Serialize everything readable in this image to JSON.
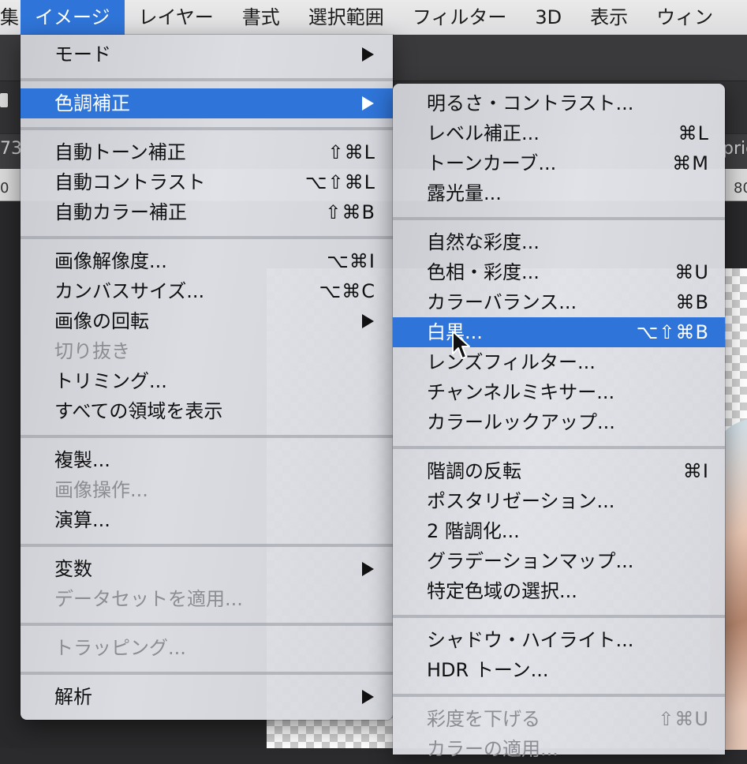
{
  "menubar": {
    "items": [
      "集",
      "イメージ",
      "レイヤー",
      "書式",
      "選択範囲",
      "フィルター",
      "3D",
      "表示",
      "ウィン"
    ]
  },
  "background": {
    "ruler_row_left": "73",
    "ruler_row_right": "pric",
    "ruler_left": "0",
    "ruler_right": "80"
  },
  "image_menu": {
    "items": [
      {
        "label": "モード",
        "submenu": true
      },
      {
        "label": "色調補正",
        "submenu": true,
        "highlighted": true
      },
      {
        "label": "自動トーン補正",
        "shortcut": "⇧⌘L"
      },
      {
        "label": "自動コントラスト",
        "shortcut": "⌥⇧⌘L"
      },
      {
        "label": "自動カラー補正",
        "shortcut": "⇧⌘B"
      },
      {
        "label": "画像解像度...",
        "shortcut": "⌥⌘I"
      },
      {
        "label": "カンバスサイズ...",
        "shortcut": "⌥⌘C"
      },
      {
        "label": "画像の回転",
        "submenu": true
      },
      {
        "label": "切り抜き",
        "disabled": true
      },
      {
        "label": "トリミング..."
      },
      {
        "label": "すべての領域を表示"
      },
      {
        "label": "複製..."
      },
      {
        "label": "画像操作...",
        "disabled": true
      },
      {
        "label": "演算..."
      },
      {
        "label": "変数",
        "submenu": true
      },
      {
        "label": "データセットを適用...",
        "disabled": true
      },
      {
        "label": "トラッピング...",
        "disabled": true
      },
      {
        "label": "解析",
        "submenu": true
      }
    ]
  },
  "adjustments_menu": {
    "items": [
      {
        "label": "明るさ・コントラスト..."
      },
      {
        "label": "レベル補正...",
        "shortcut": "⌘L"
      },
      {
        "label": "トーンカーブ...",
        "shortcut": "⌘M"
      },
      {
        "label": "露光量..."
      },
      {
        "label": "自然な彩度..."
      },
      {
        "label": "色相・彩度...",
        "shortcut": "⌘U"
      },
      {
        "label": "カラーバランス...",
        "shortcut": "⌘B"
      },
      {
        "label": "白黒...",
        "shortcut": "⌥⇧⌘B",
        "highlighted": true
      },
      {
        "label": "レンズフィルター..."
      },
      {
        "label": "チャンネルミキサー..."
      },
      {
        "label": "カラールックアップ..."
      },
      {
        "label": "階調の反転",
        "shortcut": "⌘I"
      },
      {
        "label": "ポスタリゼーション..."
      },
      {
        "label": "2 階調化..."
      },
      {
        "label": "グラデーションマップ..."
      },
      {
        "label": "特定色域の選択..."
      },
      {
        "label": "シャドウ・ハイライト..."
      },
      {
        "label": "HDR トーン..."
      },
      {
        "label": "彩度を下げる",
        "shortcut": "⇧⌘U",
        "disabled": true
      },
      {
        "label": "カラーの適用...",
        "disabled": true
      }
    ]
  },
  "colors": {
    "highlight": "#2f74d8",
    "menu_text": "#111111",
    "disabled_text": "#8c8d92"
  }
}
